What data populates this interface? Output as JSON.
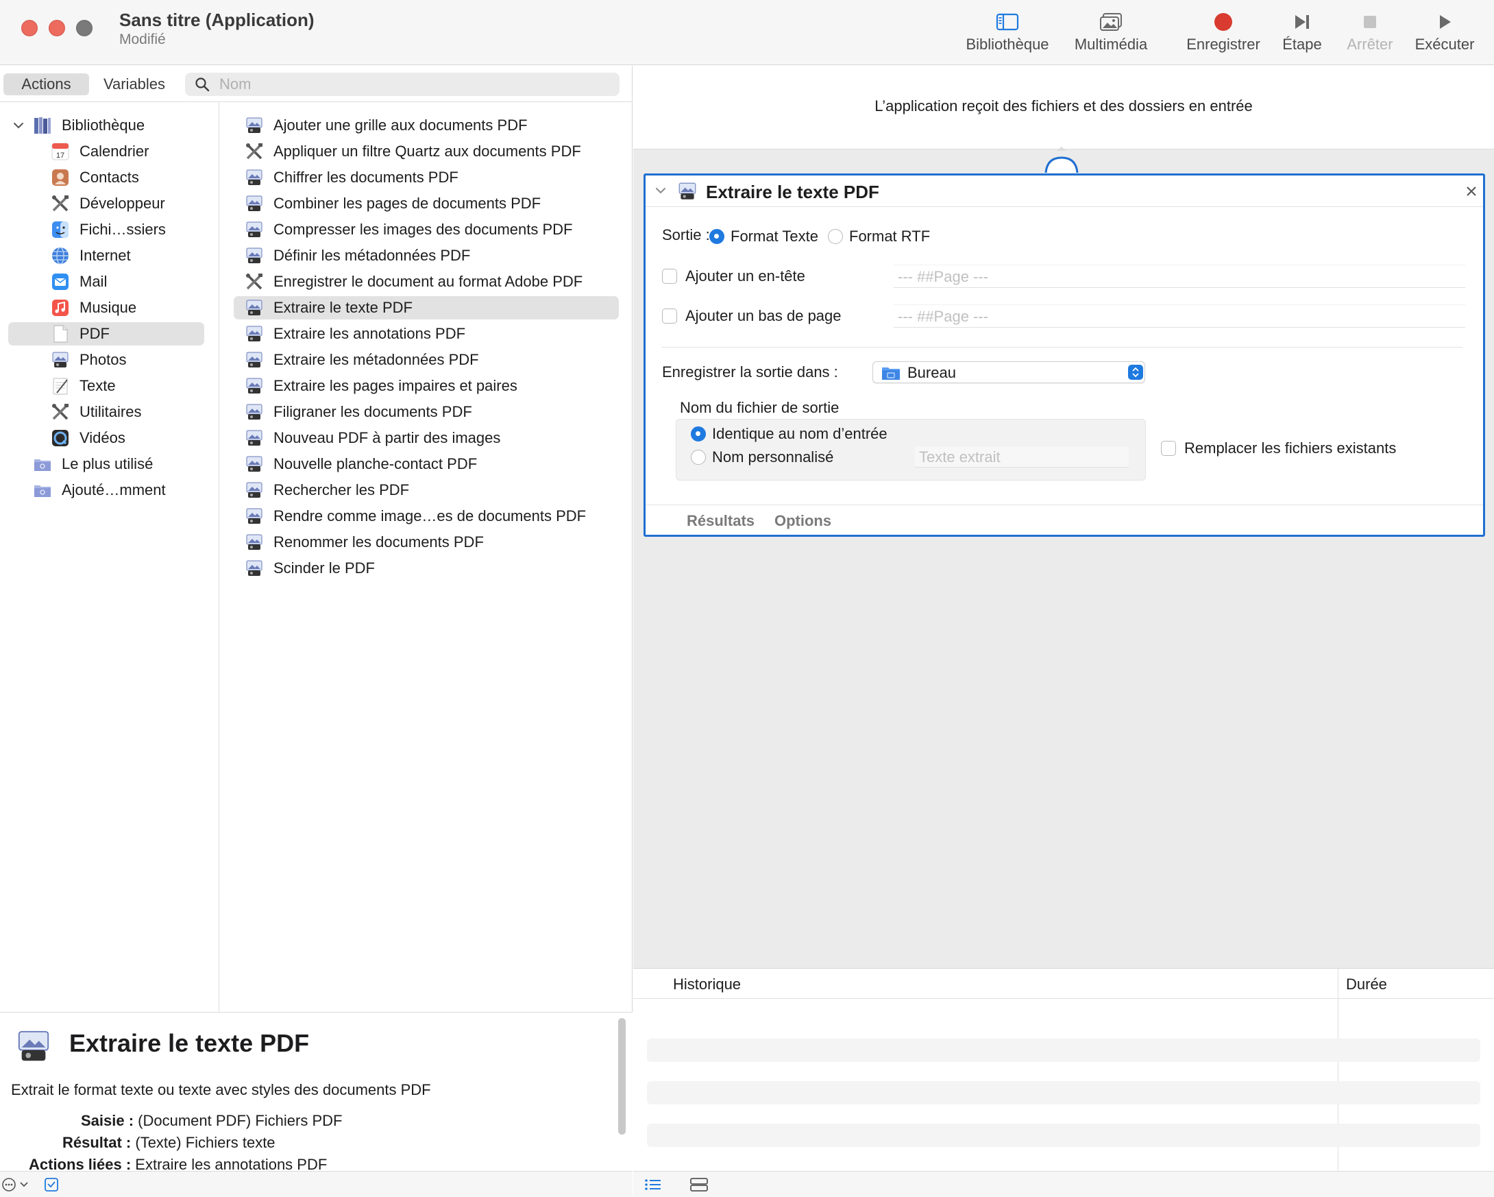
{
  "window": {
    "title": "Sans titre (Application)",
    "subtitle": "Modifié"
  },
  "toolbar": {
    "library": "Bibliothèque",
    "media": "Multimédia",
    "record": "Enregistrer",
    "step": "Étape",
    "stop": "Arrêter",
    "run": "Exécuter"
  },
  "tabs": {
    "actions": "Actions",
    "variables": "Variables"
  },
  "search": {
    "placeholder": "Nom",
    "value": ""
  },
  "library": {
    "root": "Bibliothèque",
    "items": [
      {
        "label": "Calendrier",
        "icon": "calendar-icon"
      },
      {
        "label": "Contacts",
        "icon": "contacts-icon"
      },
      {
        "label": "Développeur",
        "icon": "tools-icon"
      },
      {
        "label": "Fichi…ssiers",
        "icon": "finder-icon"
      },
      {
        "label": "Internet",
        "icon": "globe-icon"
      },
      {
        "label": "Mail",
        "icon": "mail-icon"
      },
      {
        "label": "Musique",
        "icon": "music-icon"
      },
      {
        "label": "PDF",
        "icon": "document-icon"
      },
      {
        "label": "Photos",
        "icon": "preview-icon"
      },
      {
        "label": "Texte",
        "icon": "text-edit-icon"
      },
      {
        "label": "Utilitaires",
        "icon": "tools-icon"
      },
      {
        "label": "Vidéos",
        "icon": "quicktime-icon"
      }
    ],
    "smart_groups": [
      {
        "label": "Le plus utilisé",
        "icon": "smart-folder-icon"
      },
      {
        "label": "Ajouté…mment",
        "icon": "smart-folder-icon"
      }
    ]
  },
  "actions": [
    "Ajouter une grille aux documents PDF",
    "Appliquer un filtre Quartz aux documents PDF",
    "Chiffrer les documents PDF",
    "Combiner les pages de documents PDF",
    "Compresser les images des documents PDF",
    "Définir les métadonnées PDF",
    "Enregistrer le document au format Adobe PDF",
    "Extraire le texte PDF",
    "Extraire les annotations PDF",
    "Extraire les métadonnées PDF",
    "Extraire les pages impaires et paires",
    "Filigraner les documents PDF",
    "Nouveau PDF à partir des images",
    "Nouvelle planche-contact PDF",
    "Rechercher les PDF",
    "Rendre comme image…es de documents PDF",
    "Renommer les documents PDF",
    "Scinder le PDF"
  ],
  "description": {
    "title": "Extraire le texte PDF",
    "text": "Extrait le format texte ou texte avec styles des documents PDF",
    "input_label": "Saisie :",
    "input_value": "(Document PDF) Fichiers PDF",
    "result_label": "Résultat :",
    "result_value": "(Texte) Fichiers texte",
    "related_label": "Actions liées :",
    "related_value": "Extraire les annotations PDF"
  },
  "workflow": {
    "input_banner": "L’application reçoit des fichiers et des dossiers en entrée"
  },
  "card": {
    "title": "Extraire le texte PDF",
    "output_label": "Sortie :",
    "format_text": "Format Texte",
    "format_rtf": "Format RTF",
    "header_label": "Ajouter un en-tête",
    "header_value": "--- ##Page ---",
    "footer_label": "Ajouter un bas de page",
    "footer_value": "--- ##Page ---",
    "save_label": "Enregistrer la sortie dans :",
    "save_value": "Bureau",
    "filename_label": "Nom du fichier de sortie",
    "same_name": "Identique au nom d’entrée",
    "custom_name": "Nom personnalisé",
    "custom_placeholder": "Texte extrait",
    "replace_label": "Remplacer les fichiers existants",
    "tab_results": "Résultats",
    "tab_options": "Options"
  },
  "log": {
    "col_history": "Historique",
    "col_duration": "Durée"
  },
  "colors": {
    "accent": "#1f7ae0",
    "selection_border": "#1f6fd1",
    "record": "#d93b30",
    "close_button": "#ec6a5e"
  }
}
